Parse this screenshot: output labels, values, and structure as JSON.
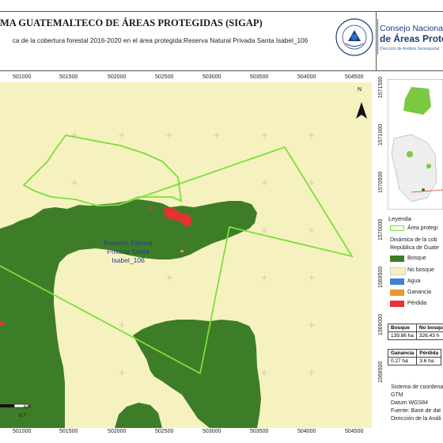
{
  "header": {
    "title": "MA GUATEMALTECO DE ÁREAS PROTEGIDAS  (SIGAP)",
    "subtitle": "ca de la cobertura forestal 2016-2020 en el área protegida:Reserva Natural Privada Santa Isabel_106",
    "logo_line1": "Consejo Nacional",
    "logo_line2": "de Áreas Protegid",
    "logo_line3": "Dirección de Análisis Geoespacial",
    "seal_text_top": "GOBIERNO DE LA REPÚBLICA DE",
    "seal_text_bottom": "GUATEMALA"
  },
  "map": {
    "x_ticks_top": [
      "501000",
      "501500",
      "502000",
      "502500",
      "503000",
      "503500",
      "504000",
      "504500"
    ],
    "x_ticks_bottom": [
      "501000",
      "501500",
      "502000",
      "502500",
      "503000",
      "503500",
      "504000",
      "504500"
    ],
    "y_ticks": [
      "1571500",
      "1571000",
      "1570500",
      "1570000",
      "1569500",
      "1569000",
      "1568500"
    ],
    "area_label_1": "Reserva Natural",
    "area_label_2": "Privada Santa",
    "area_label_3": "Isabel_106",
    "north_label": "N",
    "scale_label": "Km",
    "scale_value": "0.7"
  },
  "legend": {
    "title": "Leyenda",
    "boundary_label": "Área protegi",
    "dynamics_title_1": "Dinámica de la cob",
    "dynamics_title_2": "República de Guate",
    "items": [
      {
        "label": "Bosque",
        "color": "#3e7d28"
      },
      {
        "label": "No bosque",
        "color": "#f6f2c0"
      },
      {
        "label": "Agua",
        "color": "#3c82d8"
      },
      {
        "label": "Ganancia",
        "color": "#e89b2a"
      },
      {
        "label": "Pérdida",
        "color": "#e53333"
      }
    ],
    "boundary_color": "#7ae03a"
  },
  "stats": {
    "table1_headers": [
      "Bosque",
      "No bosqu"
    ],
    "table1_values": [
      "139.86 ha",
      "326.43 h"
    ],
    "table2_headers": [
      "Ganancia",
      "Pérdida"
    ],
    "table2_values": [
      "0.27 ha",
      "3.6 ha"
    ]
  },
  "info": {
    "line1": "Sistema de coordena",
    "line2": "GTM",
    "line3": "Datum WGS84",
    "line4": "Fuente: Base de dat",
    "line5": "Dirección de la Análi"
  }
}
